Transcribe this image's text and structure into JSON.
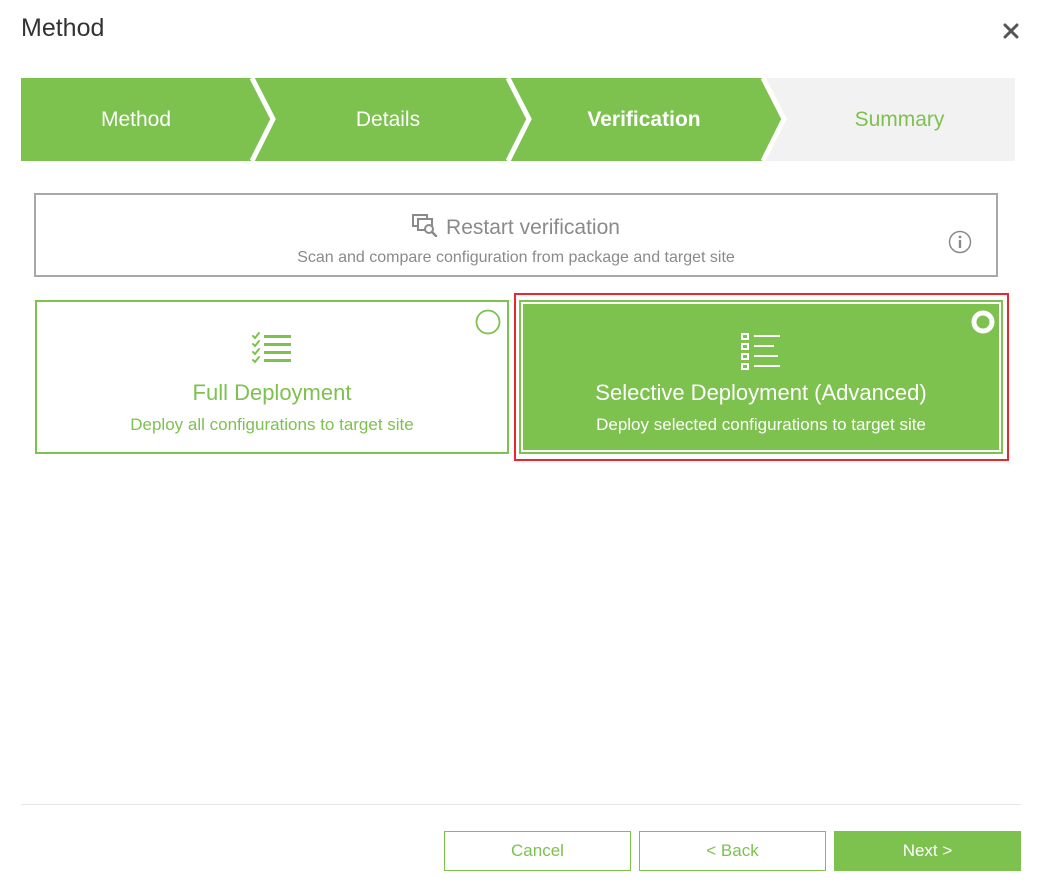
{
  "dialog": {
    "title": "Method"
  },
  "wizard": {
    "steps": [
      {
        "label": "Method",
        "state": "done"
      },
      {
        "label": "Details",
        "state": "done"
      },
      {
        "label": "Verification",
        "state": "active"
      },
      {
        "label": "Summary",
        "state": "pending"
      }
    ]
  },
  "restart": {
    "icon": "restart-verification-icon",
    "title": "Restart verification",
    "description": "Scan and compare configuration from package and target site",
    "info_icon": "info-icon"
  },
  "options": {
    "full": {
      "icon": "checklist-icon",
      "title": "Full Deployment",
      "description": "Deploy all configurations to target site",
      "selected": false
    },
    "selective": {
      "icon": "selective-list-icon",
      "title": "Selective Deployment (Advanced)",
      "description": "Deploy selected configurations to target site",
      "selected": true
    }
  },
  "buttons": {
    "cancel": "Cancel",
    "back": "< Back",
    "next": "Next >"
  },
  "colors": {
    "accent": "#7dc14f",
    "highlight": "#e8282e",
    "pending": "#f2f2f2"
  }
}
